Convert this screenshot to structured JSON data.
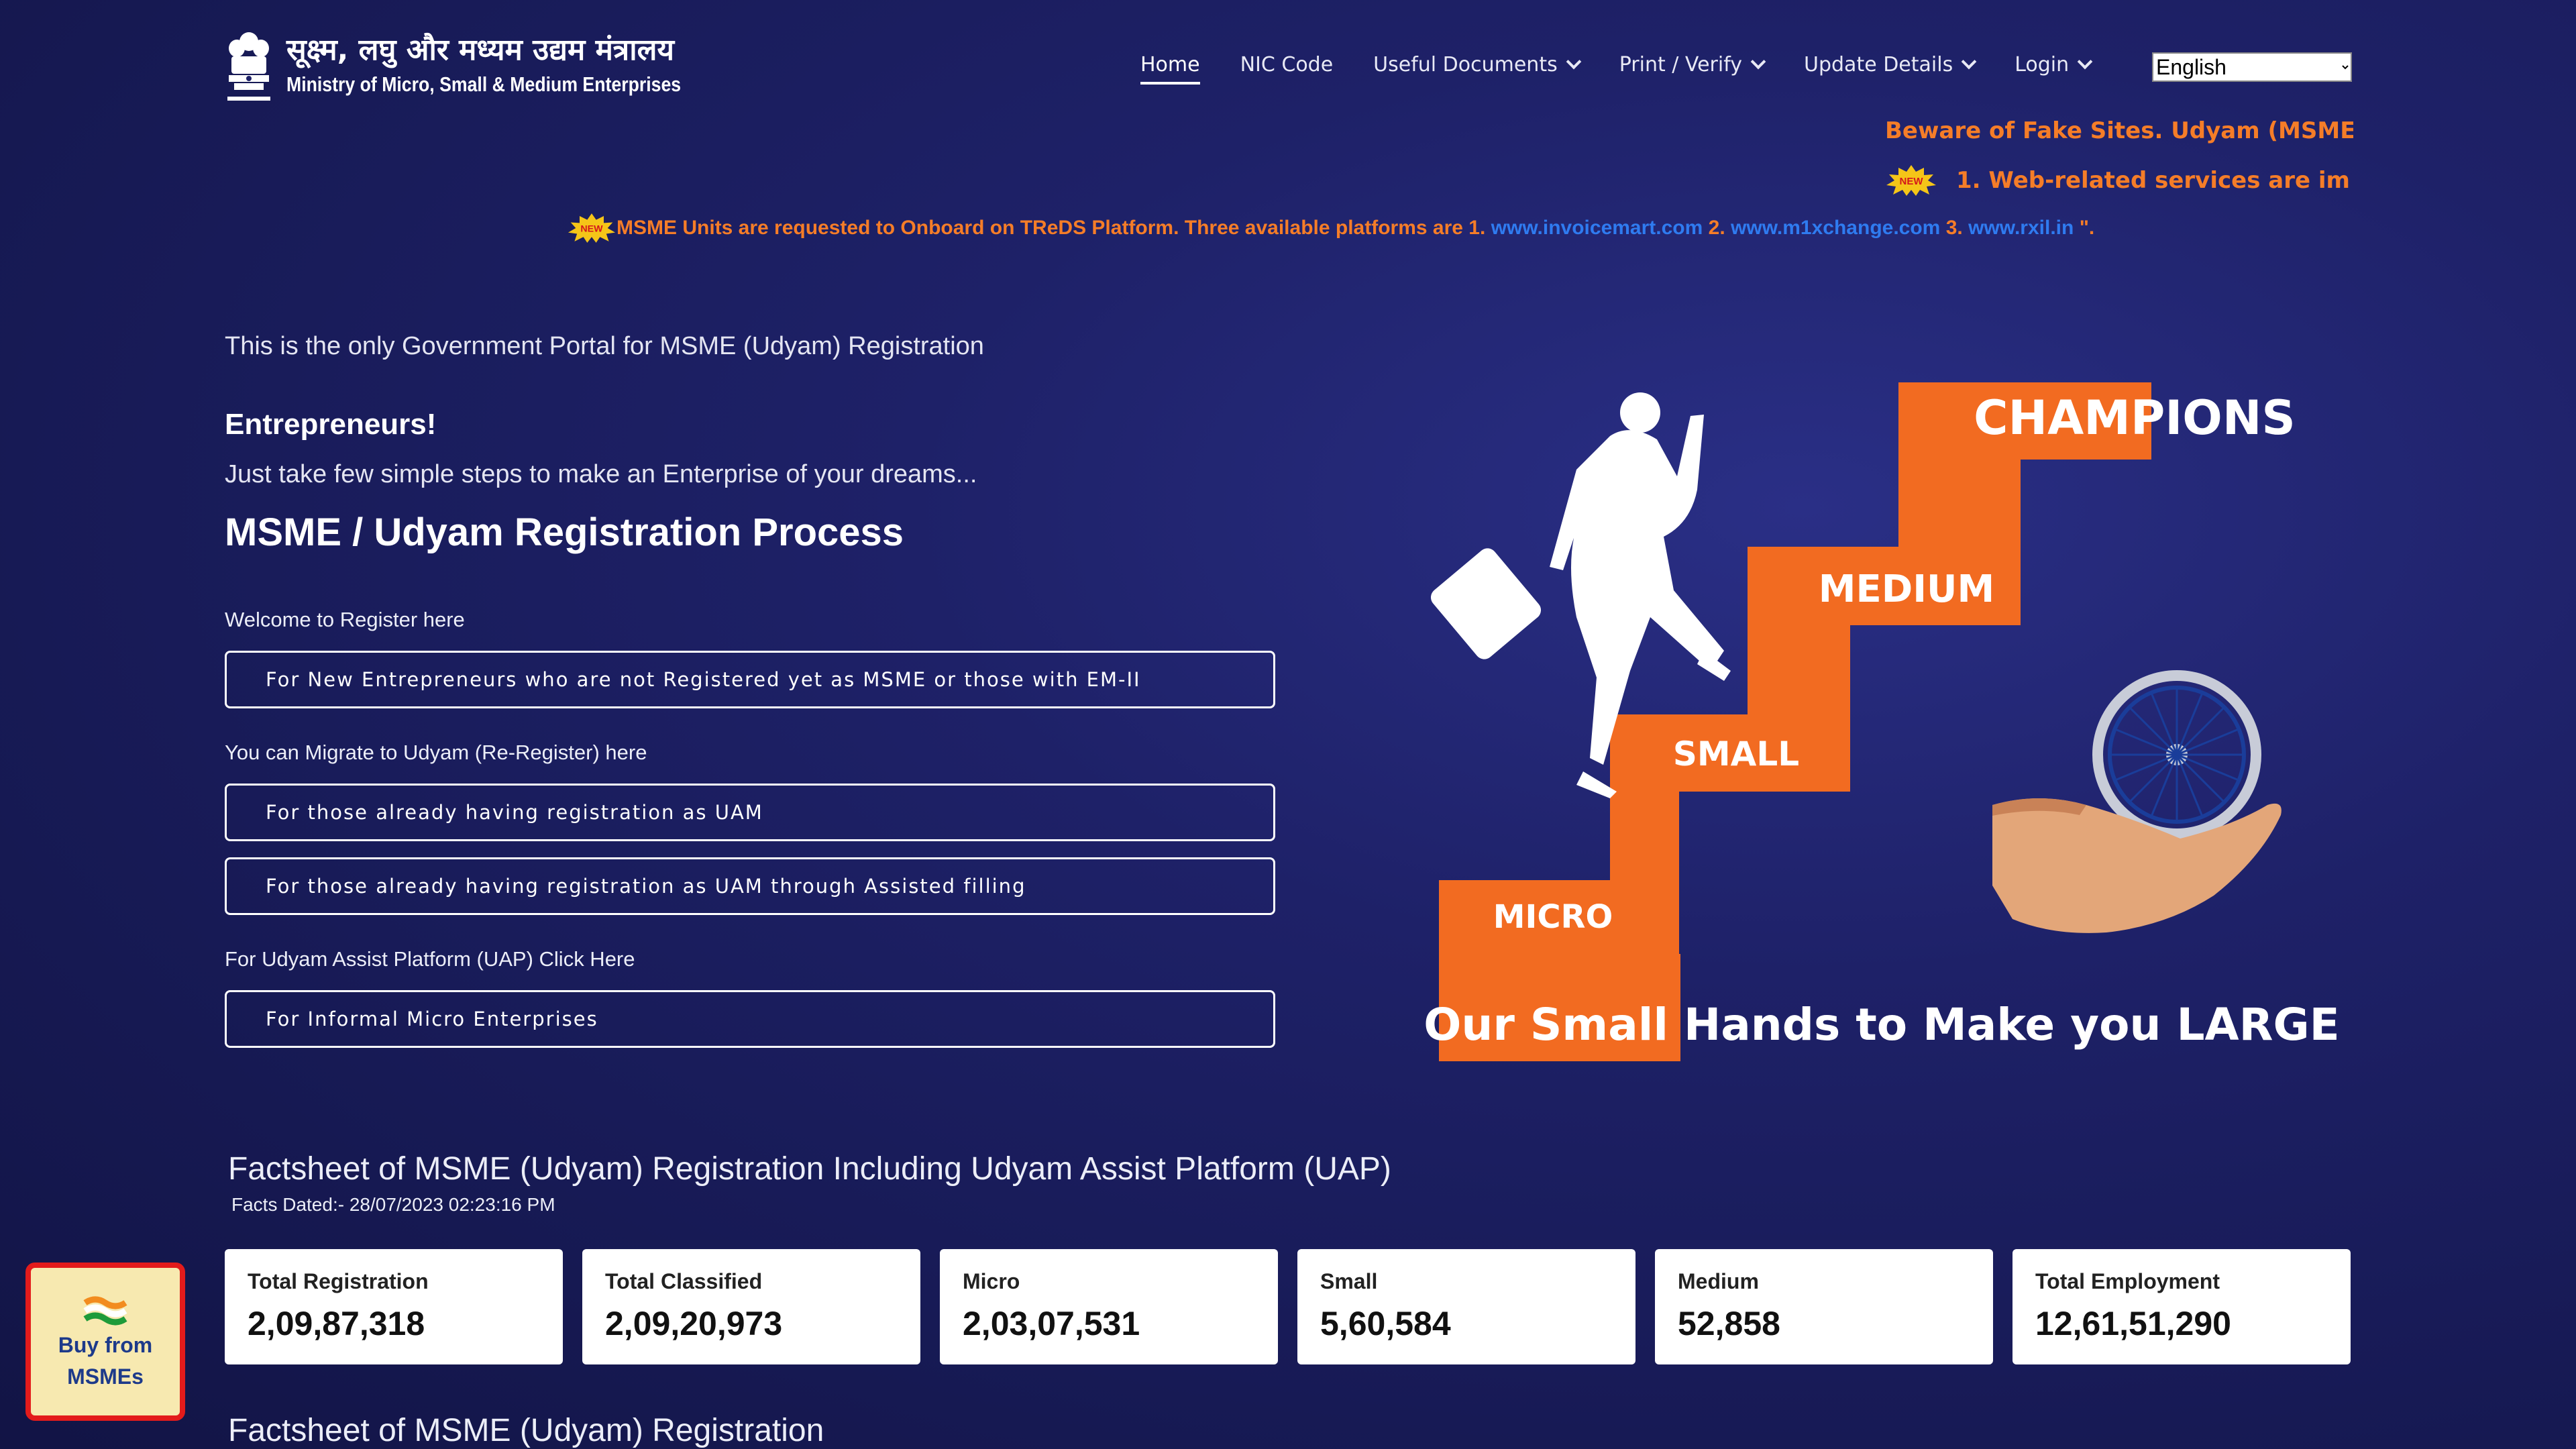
{
  "header": {
    "logo_hindi": "सूक्ष्म, लघु और मध्यम उद्यम मंत्रालय",
    "logo_english": "Ministry of Micro, Small & Medium Enterprises",
    "nav": [
      {
        "label": "Home",
        "active": true,
        "dropdown": false
      },
      {
        "label": "NIC Code",
        "active": false,
        "dropdown": false
      },
      {
        "label": "Useful Documents",
        "active": false,
        "dropdown": true
      },
      {
        "label": "Print / Verify",
        "active": false,
        "dropdown": true
      },
      {
        "label": "Update Details",
        "active": false,
        "dropdown": true
      },
      {
        "label": "Login",
        "active": false,
        "dropdown": true
      }
    ],
    "language_selected": "English"
  },
  "notices": {
    "beware_text": "Beware of Fake Sites. Udyam (MSME",
    "web_services_text": "1. Web-related services are im",
    "new_badge": "NEW",
    "treds_text": "MSME Units are requested to Onboard on TReDS Platform. Three available platforms are 1.",
    "treds_link1": "www.invoicemart.com",
    "treds_sep2": "2.",
    "treds_link2": "www.m1xchange.com",
    "treds_sep3": "3.",
    "treds_link3": "www.rxil.in",
    "treds_end": "\"."
  },
  "intro": {
    "only_portal": "This is the only Government Portal for MSME (Udyam) Registration",
    "entrepreneurs": "Entrepreneurs!",
    "steps": "Just take few simple steps to make an Enterprise of your dreams...",
    "process_title": "MSME / Udyam Registration Process"
  },
  "registration": {
    "welcome_label": "Welcome to Register here",
    "new_button": "For New Entrepreneurs who are not Registered yet as MSME or those with EM-II",
    "migrate_label": "You can Migrate to Udyam (Re-Register) here",
    "uam_button": "For those already having registration as UAM",
    "uam_assisted_button": "For those already having registration as UAM through Assisted filling",
    "uap_label": "For Udyam Assist Platform (UAP) Click Here",
    "informal_button": "For Informal Micro Enterprises"
  },
  "hero": {
    "steps": [
      "MICRO",
      "SMALL",
      "MEDIUM",
      "CHAMPIONS"
    ],
    "tagline": "Our Small Hands to Make you LARGE",
    "accent_color": "#f26b21"
  },
  "factsheet": {
    "title": "Factsheet of MSME (Udyam) Registration Including Udyam Assist Platform (UAP)",
    "dated": "Facts Dated:- 28/07/2023 02:23:16 PM",
    "cards": [
      {
        "title": "Total Registration",
        "value": "2,09,87,318"
      },
      {
        "title": "Total Classified",
        "value": "2,09,20,973"
      },
      {
        "title": "Micro",
        "value": "2,03,07,531"
      },
      {
        "title": "Small",
        "value": "5,60,584"
      },
      {
        "title": "Medium",
        "value": "52,858"
      },
      {
        "title": "Total Employment",
        "value": "12,61,51,290"
      }
    ],
    "second_title": "Factsheet of MSME (Udyam) Registration"
  },
  "buy_widget": {
    "line1": "Buy from",
    "line2": "MSMEs"
  }
}
